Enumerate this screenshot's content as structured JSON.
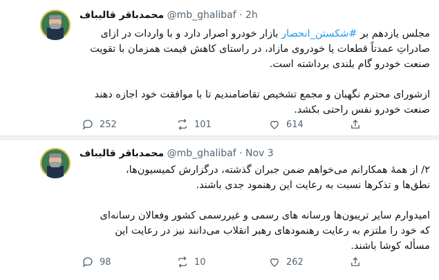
{
  "tweets": [
    {
      "author_name": "محمدباقر قالیباف",
      "handle": "@mb_ghalibaf",
      "separator": "·",
      "time": "2h",
      "line1_pre": "مجلس یازدهم بر ",
      "line1_tag": "#شکستن_انحصار",
      "line1_post": " بازار خودرو اصرار دارد و با واردات در ازای",
      "rest": "صادراتِ عمدتاً قطعات یا خودروی مازاد، در راستای کاهش قیمت همزمان با تقویت\nصنعت خودرو گام بلندی برداشته است.\n\nازشورای محترم نگهبان و مجمع تشخیص تقاضامندیم تا با موافقت خود اجازه دهند\nصنعت خودرو نفس راحتی بکشد.",
      "replies": "252",
      "retweets": "101",
      "likes": "614"
    },
    {
      "author_name": "محمدباقر قالیباف",
      "handle": "@mb_ghalibaf",
      "separator": "·",
      "time": "Nov 3",
      "text": "۲/ از همۀ همکارانم می‌خواهم ضمن جبران گذشته، درگزارش کمیسیون‌ها،\nنطق‌ها و تذکرها نسبت به رعایت این رهنمود جدی باشند.\n\nامیدوارم سایر تریبون‌ها ورسانه های رسمی و غیررسمی کشور وفعالان رسانه‌ای\nکه خود را ملتزم به رعایت رهنمودهای رهبر انقلاب می‌دانند نیز در رعایت این\nمسأله کوشا باشند.",
      "replies": "98",
      "retweets": "10",
      "likes": "262"
    }
  ],
  "colors": {
    "link": "#1d9bf0",
    "muted": "#536471",
    "text": "#0f1419",
    "background": "#f0f2f3"
  },
  "icons": [
    "reply-icon",
    "retweet-icon",
    "like-icon",
    "share-icon"
  ]
}
